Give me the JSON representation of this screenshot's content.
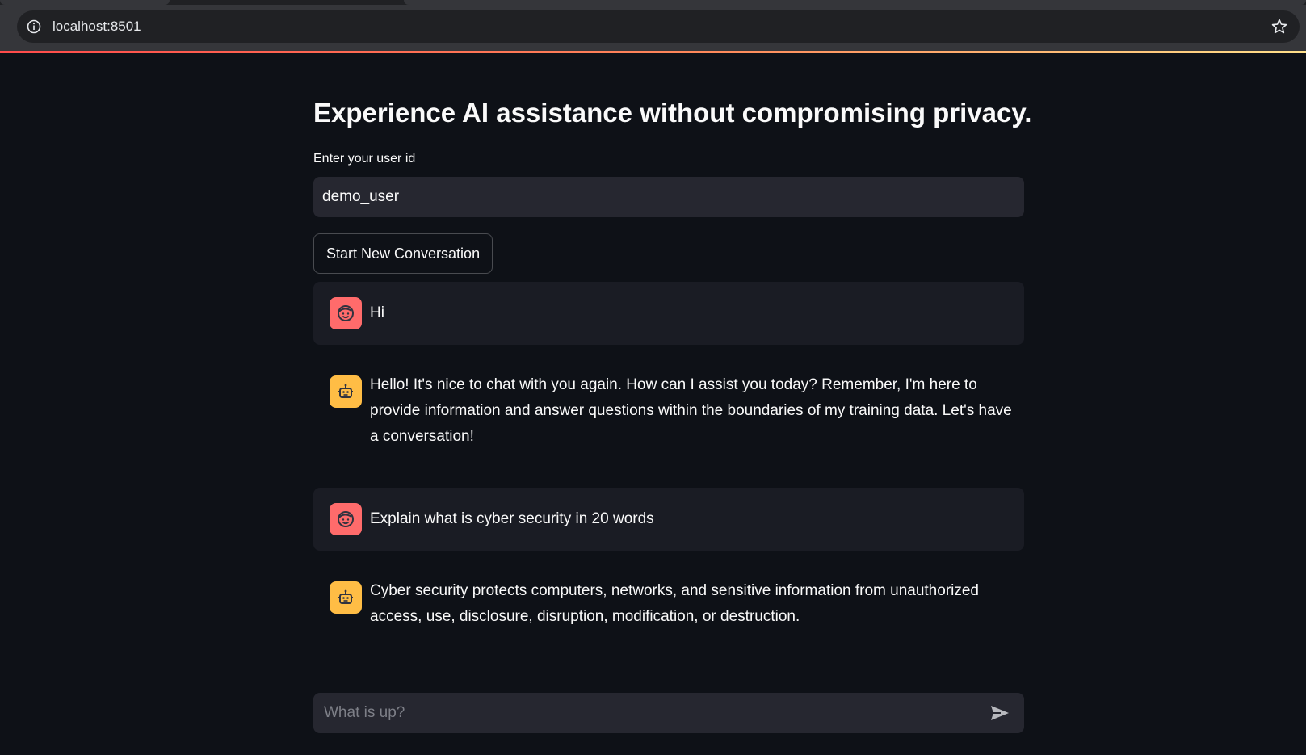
{
  "browser": {
    "url": "localhost:8501"
  },
  "app": {
    "title": "Experience AI assistance without compromising privacy.",
    "user_id_label": "Enter your user id",
    "user_id_value": "demo_user",
    "new_conversation_label": "Start New Conversation",
    "messages": [
      {
        "role": "user",
        "text": "Hi"
      },
      {
        "role": "assistant",
        "text": "Hello! It's nice to chat with you again. How can I assist you today? Remember, I'm here to provide information and answer questions within the boundaries of my training data. Let's have a conversation!"
      },
      {
        "role": "user",
        "text": "Explain what is cyber security in 20 words"
      },
      {
        "role": "assistant",
        "text": "Cyber security protects computers, networks, and sensitive information from unauthorized access, use, disclosure, disruption, modification, or destruction."
      }
    ],
    "chat_placeholder": "What is up?"
  },
  "colors": {
    "background": "#0e1117",
    "user_avatar": "#ff6b6b",
    "assistant_avatar": "#ffbd45",
    "input_bg": "#262730"
  },
  "icons": {
    "user_avatar": "smiling-face-icon",
    "assistant_avatar": "robot-icon",
    "send": "send-arrow-icon",
    "bookmark": "star-icon",
    "site_info": "info-icon"
  }
}
